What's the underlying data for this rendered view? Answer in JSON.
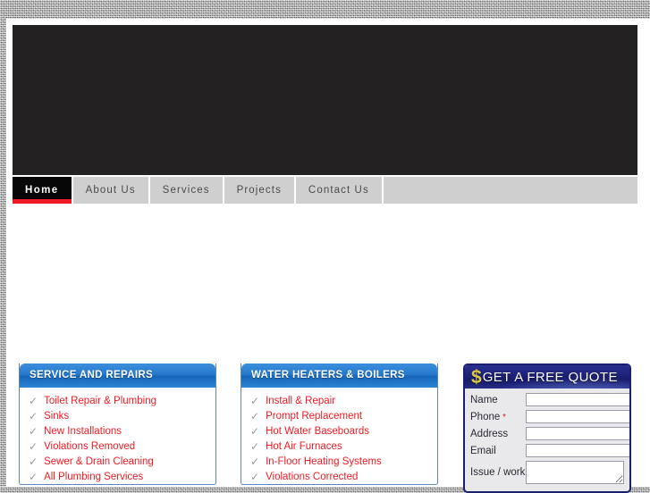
{
  "nav": {
    "items": [
      {
        "label": "Home",
        "active": true
      },
      {
        "label": "About Us",
        "active": false
      },
      {
        "label": "Services",
        "active": false
      },
      {
        "label": "Projects",
        "active": false
      },
      {
        "label": "Contact Us",
        "active": false
      }
    ]
  },
  "panels": [
    {
      "id": "services",
      "title": "SERVICE AND REPAIRS",
      "items": [
        "Toilet Repair & Plumbing",
        "Sinks",
        "New Installations",
        "Violations Removed",
        "Sewer & Drain Cleaning",
        "All Plumbing Services"
      ]
    },
    {
      "id": "heaters",
      "title": "WATER HEATERS & BOILERS",
      "items": [
        "Install & Repair",
        "Prompt Replacement",
        "Hot Water Baseboards",
        "Hot Air Furnaces",
        "In-Floor Heating Systems",
        "Violations Corrected"
      ]
    }
  ],
  "quote": {
    "icon": "dollar-sign-icon",
    "icon_glyph": "$",
    "title": "GET A FREE QUOTE",
    "fields": [
      {
        "label": "Name",
        "required": false,
        "value": "",
        "type": "text"
      },
      {
        "label": "Phone",
        "required": true,
        "value": "",
        "type": "text"
      },
      {
        "label": "Address",
        "required": false,
        "value": "",
        "type": "text"
      },
      {
        "label": "Email",
        "required": false,
        "value": "",
        "type": "text"
      },
      {
        "label": "Issue / work",
        "required": false,
        "value": "",
        "type": "textarea"
      }
    ],
    "required_marker": "*"
  },
  "colors": {
    "accent_red": "#ef1b24",
    "panel_blue": "#2579cb",
    "quote_navy": "#1e2279",
    "dollar_gold": "#d9c84a",
    "banner_dark": "#232122",
    "nav_gray": "#cfcfcf"
  }
}
